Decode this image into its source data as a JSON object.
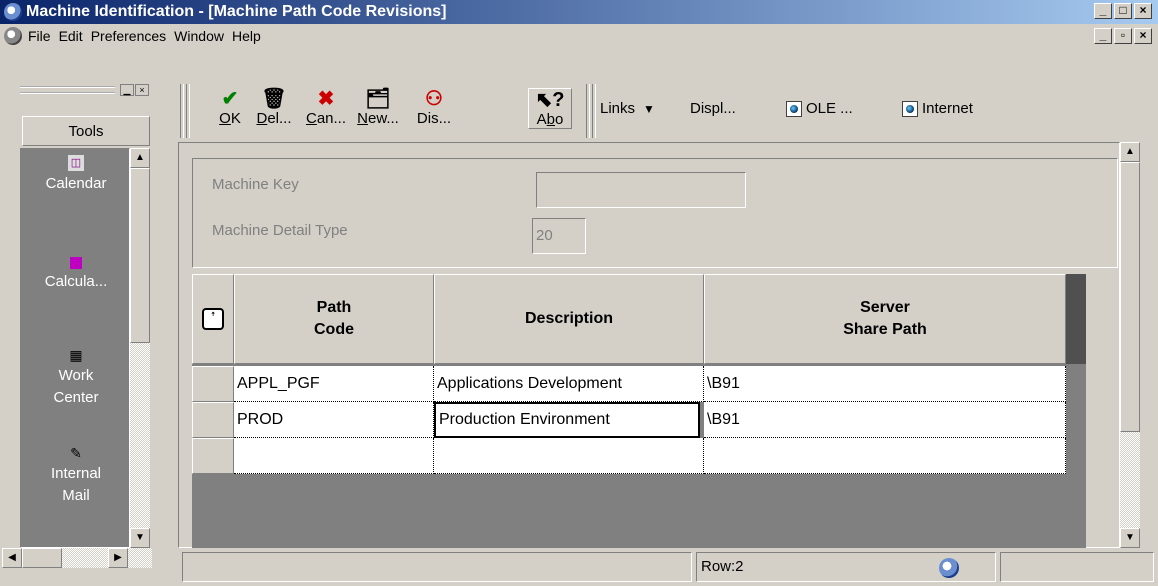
{
  "window": {
    "title": "Machine Identification - [Machine Path Code Revisions]",
    "controls": [
      "_",
      "□",
      "×"
    ],
    "mdi_controls": [
      "_",
      "▫",
      "×"
    ]
  },
  "menu": {
    "items": [
      "File",
      "Edit",
      "Preferences",
      "Window",
      "Help"
    ]
  },
  "tools": {
    "header": "Tools",
    "items": [
      {
        "label": "Calendar",
        "icon": "calendar-icon"
      },
      {
        "label": "Calcula...",
        "icon": "calculator-icon"
      },
      {
        "label": "Work Center",
        "label_lines": [
          "Work",
          "Center"
        ],
        "icon": "work-center-icon"
      },
      {
        "label": "Internal Mail",
        "label_lines": [
          "Internal",
          "Mail"
        ],
        "icon": "mail-icon"
      }
    ]
  },
  "toolbar": {
    "buttons": [
      {
        "name": "ok",
        "label": "OK",
        "underline": "O",
        "rest": "K",
        "icon": "check-icon",
        "color": "#008000"
      },
      {
        "name": "delete",
        "label": "Del...",
        "underline": "D",
        "rest": "el...",
        "icon": "trash-icon",
        "color": "#000000"
      },
      {
        "name": "cancel",
        "label": "Can...",
        "underline": "C",
        "rest": "an...",
        "icon": "x-icon",
        "color": "#cc0000"
      },
      {
        "name": "new",
        "label": "New...",
        "underline": "N",
        "rest": "ew...",
        "icon": "new-folder-icon",
        "color": "#000000"
      },
      {
        "name": "display",
        "label": "Dis...",
        "underline": "",
        "rest": "Dis...",
        "icon": "binoculars-icon",
        "color": "#cc0000"
      },
      {
        "name": "about",
        "label": "Abo",
        "underline": "b",
        "pre": "A",
        "rest": "o",
        "icon": "help-pointer-icon",
        "color": "#000000"
      }
    ],
    "links": {
      "links_label": "Links",
      "display_label": "Displ...",
      "ole_label": "OLE ...",
      "internet_label": "Internet"
    }
  },
  "form": {
    "machine_key_label": "Machine Key",
    "machine_key_value": "",
    "detail_type_label": "Machine Detail Type",
    "detail_type_value": "20"
  },
  "grid": {
    "columns": [
      {
        "lines": [
          "Path",
          "Code"
        ]
      },
      {
        "lines": [
          "Description"
        ]
      },
      {
        "lines": [
          "Server",
          "Share Path"
        ]
      }
    ],
    "rows": [
      [
        "APPL_PGF",
        "Applications Development",
        "\\B91"
      ],
      [
        "PROD",
        "Production Environment",
        "\\B91"
      ],
      [
        "",
        "",
        ""
      ]
    ],
    "focused_cell": {
      "row": 1,
      "col": 1
    }
  },
  "status": {
    "row_text": "Row:2"
  }
}
